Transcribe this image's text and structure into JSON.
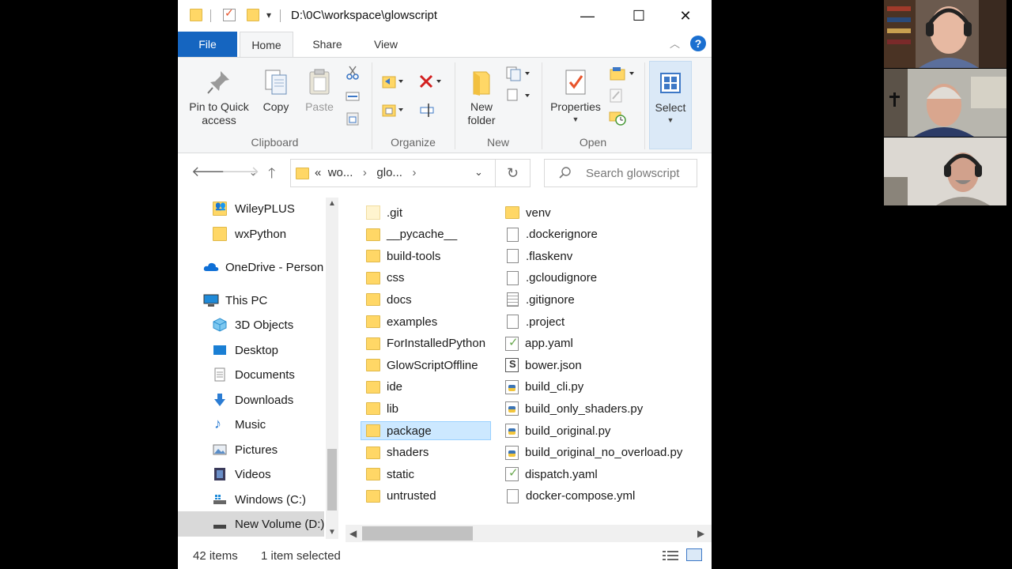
{
  "window": {
    "title": "D:\\0C\\workspace\\glowscript",
    "controls": {
      "minimize": "—",
      "maximize": "☐",
      "close": "✕"
    }
  },
  "ribbon_tabs": {
    "file": "File",
    "home": "Home",
    "share": "Share",
    "view": "View",
    "help": "?"
  },
  "ribbon": {
    "clipboard": {
      "label": "Clipboard",
      "pin": "Pin to Quick access",
      "copy": "Copy",
      "paste": "Paste"
    },
    "organize": {
      "label": "Organize"
    },
    "new": {
      "label": "New",
      "new_folder": "New folder"
    },
    "open": {
      "label": "Open",
      "properties": "Properties"
    },
    "select": {
      "label": "Select"
    }
  },
  "address": {
    "segments": [
      "«",
      "wo...",
      "›",
      "glo...",
      "›"
    ],
    "search_placeholder": "Search glowscript"
  },
  "nav": [
    {
      "label": "WileyPLUS",
      "icon": "folder-user-icon"
    },
    {
      "label": "wxPython",
      "icon": "folder-icon"
    },
    {
      "label": "OneDrive - Person",
      "icon": "onedrive-icon"
    },
    {
      "label": "This PC",
      "icon": "pc-icon"
    },
    {
      "label": "3D Objects",
      "icon": "cube-icon"
    },
    {
      "label": "Desktop",
      "icon": "desktop-icon"
    },
    {
      "label": "Documents",
      "icon": "documents-icon"
    },
    {
      "label": "Downloads",
      "icon": "download-icon"
    },
    {
      "label": "Music",
      "icon": "music-icon"
    },
    {
      "label": "Pictures",
      "icon": "pictures-icon"
    },
    {
      "label": "Videos",
      "icon": "videos-icon"
    },
    {
      "label": "Windows (C:)",
      "icon": "drive-c-icon"
    },
    {
      "label": "New Volume (D:)",
      "icon": "drive-d-icon"
    }
  ],
  "files_col1": [
    {
      "name": ".git",
      "type": "git"
    },
    {
      "name": "__pycache__",
      "type": "folder"
    },
    {
      "name": "build-tools",
      "type": "folder"
    },
    {
      "name": "css",
      "type": "folder"
    },
    {
      "name": "docs",
      "type": "folder"
    },
    {
      "name": "examples",
      "type": "folder"
    },
    {
      "name": "ForInstalledPython",
      "type": "folder"
    },
    {
      "name": "GlowScriptOffline",
      "type": "folder"
    },
    {
      "name": "ide",
      "type": "folder"
    },
    {
      "name": "lib",
      "type": "folder"
    },
    {
      "name": "package",
      "type": "folder",
      "selected": true
    },
    {
      "name": "shaders",
      "type": "folder"
    },
    {
      "name": "static",
      "type": "folder"
    },
    {
      "name": "untrusted",
      "type": "folder"
    }
  ],
  "files_col2": [
    {
      "name": "venv",
      "type": "folder"
    },
    {
      "name": ".dockerignore",
      "type": "doc"
    },
    {
      "name": ".flaskenv",
      "type": "doc"
    },
    {
      "name": ".gcloudignore",
      "type": "doc"
    },
    {
      "name": ".gitignore",
      "type": "txt"
    },
    {
      "name": ".project",
      "type": "doc"
    },
    {
      "name": "app.yaml",
      "type": "yaml"
    },
    {
      "name": "bower.json",
      "type": "json"
    },
    {
      "name": "build_cli.py",
      "type": "py"
    },
    {
      "name": "build_only_shaders.py",
      "type": "py"
    },
    {
      "name": "build_original.py",
      "type": "py"
    },
    {
      "name": "build_original_no_overload.py",
      "type": "py"
    },
    {
      "name": "dispatch.yaml",
      "type": "yaml"
    },
    {
      "name": "docker-compose.yml",
      "type": "doc"
    }
  ],
  "status": {
    "count": "42 items",
    "selection": "1 item selected"
  },
  "colors": {
    "accent": "#1565c0",
    "folder": "#ffd766",
    "selection": "#cce8ff"
  }
}
